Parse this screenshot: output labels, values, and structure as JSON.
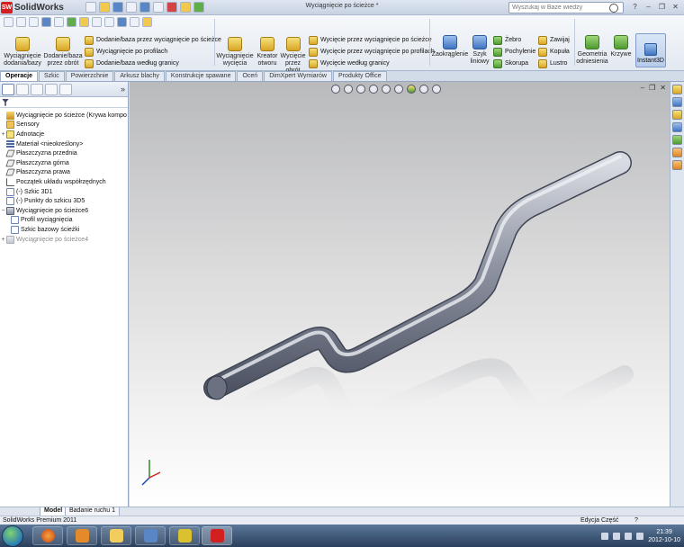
{
  "app": {
    "logo_text": "SolidWorks",
    "document_title": "Wyciągnięcie po ścieżce *",
    "search_placeholder": "Wyszukaj w Baze wiedzy"
  },
  "ribbon": {
    "extrude_boss": "Wyciągnięcie dodania/bazy",
    "revolve_boss": "Dodanie/baza przez obrót",
    "sweep_boss": "Dodanie/baza przez wyciągnięcie po ścieżce",
    "loft_boss": "Wyciągnięcie po profilach",
    "boundary_boss": "Dodanie/baza według granicy",
    "extrude_cut": "Wyciągnięcie wycięcia",
    "hole_wizard": "Kreator otworu",
    "revolve_cut": "Wycięcie przez obrót",
    "sweep_cut": "Wycięcie przez wyciągnięcie po ścieżce",
    "loft_cut": "Wycięcie przez wyciągnięcie po profilach",
    "boundary_cut": "Wycięcie według granicy",
    "fillet": "Zaokrąglenie",
    "linear_pattern": "Szyk liniowy",
    "rib": "Żebro",
    "draft": "Pochylenie",
    "shell": "Skorupa",
    "wrap": "Zawijaj",
    "dome": "Kopuła",
    "mirror": "Lustro",
    "ref_geometry": "Geometria odniesienia",
    "curves": "Krzywe",
    "instant3d": "Instant3D"
  },
  "tabs": [
    "Operacje",
    "Szkic",
    "Powierzchnie",
    "Arkusz blachy",
    "Konstrukcje spawane",
    "Oceń",
    "DimXpert Wymiarów",
    "Produkty Office"
  ],
  "tree": {
    "root": "Wyciągnięcie po ścieżce  (Krywa kompo",
    "sensors": "Sensory",
    "annotations": "Adnotacje",
    "material": "Materiał <nieokreślony>",
    "front_plane": "Płaszczyzna przednia",
    "top_plane": "Płaszczyzna górna",
    "right_plane": "Płaszczyzna prawa",
    "origin": "Początek układu współrzędnych",
    "sketch1": "(-) Szkic 3D1",
    "points": "(-) Punkty do szkicu 3D5",
    "sweep6": "Wyciągnięcie po ścieżce6",
    "profile": "Profil wyciągnięcia",
    "path_sketch": "Szkic bazowy ścieżki",
    "sweep4": "Wyciągnięcie po ścieżce4"
  },
  "bottom_tabs": [
    "Model",
    "Badanie ruchu 1"
  ],
  "status": {
    "left": "SolidWorks Premium 2011",
    "mode": "Edycja Część"
  },
  "clock": {
    "time": "21:39",
    "date": "2012-10-10"
  },
  "colors": {
    "accent": "#3f73bf",
    "logo_red": "#d21f1f"
  }
}
